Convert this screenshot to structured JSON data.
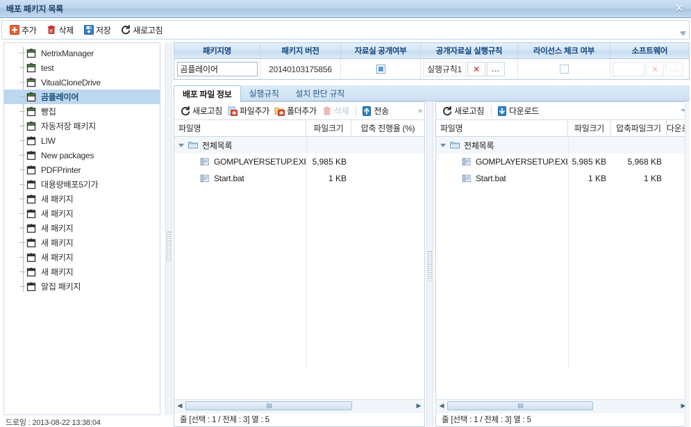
{
  "window": {
    "title": "배포 패키지 목록",
    "close_label": "✕"
  },
  "main_toolbar": {
    "items": [
      {
        "label": "추가",
        "icon": "plus-icon"
      },
      {
        "label": "삭제",
        "icon": "trash-icon"
      },
      {
        "label": "저장",
        "icon": "save-icon"
      },
      {
        "label": "새로고침",
        "icon": "refresh-icon"
      }
    ]
  },
  "tree": {
    "items": [
      {
        "label": "NetrixManager",
        "icon": "package-green-icon",
        "selected": false
      },
      {
        "label": "test",
        "icon": "package-green-icon",
        "selected": false
      },
      {
        "label": "VitualCloneDrive",
        "icon": "package-green-icon",
        "selected": false
      },
      {
        "label": "곰플레이어",
        "icon": "package-green-icon",
        "selected": true
      },
      {
        "label": "빵집",
        "icon": "package-green-icon",
        "selected": false
      },
      {
        "label": "자동저장 패키지",
        "icon": "package-green-icon",
        "selected": false
      },
      {
        "label": "LIW",
        "icon": "package-gray-icon",
        "selected": false
      },
      {
        "label": "New packages",
        "icon": "package-gray-icon",
        "selected": false
      },
      {
        "label": "PDFPrinter",
        "icon": "package-gray-icon",
        "selected": false
      },
      {
        "label": "대용량배포5기가",
        "icon": "package-gray-icon",
        "selected": false
      },
      {
        "label": "새 패키지",
        "icon": "package-gray-icon",
        "selected": false
      },
      {
        "label": "새 패키지",
        "icon": "package-gray-icon",
        "selected": false
      },
      {
        "label": "새 패키지",
        "icon": "package-gray-icon",
        "selected": false
      },
      {
        "label": "새 패키지",
        "icon": "package-gray-icon",
        "selected": false
      },
      {
        "label": "새 패키지",
        "icon": "package-gray-icon",
        "selected": false
      },
      {
        "label": "새 패키지",
        "icon": "package-gray-icon",
        "selected": false
      },
      {
        "label": "알집 패키지",
        "icon": "package-gray-icon",
        "selected": false
      }
    ]
  },
  "status_left": "드로잉 : 2013-08-22 13:38:04",
  "property_grid": {
    "headers": [
      "패키지명",
      "패키지 버전",
      "자료실 공개여부",
      "공개자료실 실행규칙",
      "라이선스 체크 여부",
      "소프트웨어"
    ],
    "row": {
      "package_name": "곰플레이어",
      "package_version": "20140103175856",
      "public_check": true,
      "public_rule": "실행규칙1",
      "public_rule_clear": "✕",
      "public_rule_browse": "...",
      "license_check": false,
      "software": "",
      "software_clear": "✕",
      "software_browse": "..."
    }
  },
  "tabs": [
    {
      "label": "배포 파일 정보",
      "active": true
    },
    {
      "label": "실행규칙",
      "active": false
    },
    {
      "label": "설치 판단 규칙",
      "active": false
    }
  ],
  "left_panel": {
    "toolbar": [
      {
        "label": "새로고침",
        "icon": "refresh-icon",
        "disabled": false
      },
      {
        "label": "파일추가",
        "icon": "file-add-icon",
        "disabled": false
      },
      {
        "label": "폴더추가",
        "icon": "folder-add-icon",
        "disabled": false
      },
      {
        "label": "삭제",
        "icon": "trash-icon",
        "disabled": true
      },
      {
        "label": "전송",
        "icon": "upload-icon",
        "disabled": false
      }
    ],
    "overflow": "»",
    "headers": [
      "파일명",
      "파일크기",
      "압축 진행율 (%)"
    ],
    "rows": [
      {
        "type": "group",
        "name": "전체목록",
        "icon": "folder-icon",
        "size": "",
        "progress": ""
      },
      {
        "type": "file",
        "name": "GOMPLAYERSETUP.EXE",
        "icon": "file-icon",
        "size": "5,985 KB",
        "progress": ""
      },
      {
        "type": "file",
        "name": "Start.bat",
        "icon": "file-icon",
        "size": "1 KB",
        "progress": ""
      }
    ],
    "status": "줄 [선택 : 1 / 전체 : 3] 열 : 5"
  },
  "right_panel": {
    "toolbar": [
      {
        "label": "새로고침",
        "icon": "refresh-icon",
        "disabled": false
      },
      {
        "label": "다운로드",
        "icon": "download-icon",
        "disabled": false
      }
    ],
    "headers": [
      "파일명",
      "파일크기",
      "압축파일크기",
      "다운로"
    ],
    "rows": [
      {
        "type": "group",
        "name": "전체목록",
        "icon": "folder-icon",
        "size": "",
        "zipsize": "",
        "dl": ""
      },
      {
        "type": "file",
        "name": "GOMPLAYERSETUP.EXE",
        "icon": "file-icon",
        "size": "5,985 KB",
        "zipsize": "5,968 KB",
        "dl": ""
      },
      {
        "type": "file",
        "name": "Start.bat",
        "icon": "file-icon",
        "size": "1 KB",
        "zipsize": "1 KB",
        "dl": ""
      }
    ],
    "status": "줄 [선택 : 1 / 전체 : 3] 열 : 5"
  },
  "scroll": {
    "left_arrow": "◀",
    "right_arrow": "▶"
  },
  "colors": {
    "titlebar": "#bcd4ec",
    "accent": "#12467f",
    "selection": "#bcd7ee",
    "package_green": "#4a9c3f",
    "package_gray": "#3c3c3c",
    "danger": "#cf2323"
  }
}
